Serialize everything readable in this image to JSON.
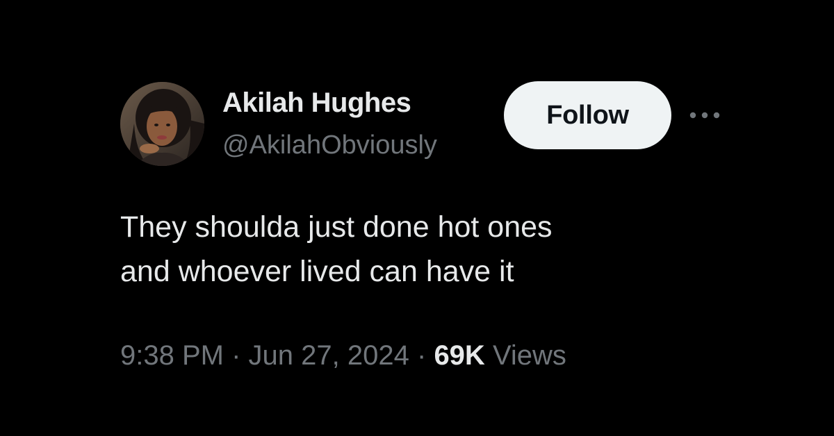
{
  "author": {
    "display_name": "Akilah Hughes",
    "handle": "@AkilahObviously",
    "avatar_alt": "profile photo"
  },
  "follow_button": {
    "label": "Follow"
  },
  "more_button": {
    "icon": "more-horizontal-icon"
  },
  "tweet": {
    "text_lines": [
      "They shoulda just done hot ones",
      "and whoever lived can have it"
    ]
  },
  "meta": {
    "time": "9:38 PM",
    "separator": "·",
    "date": "Jun 27, 2024",
    "views_count": "69K",
    "views_label": "Views"
  },
  "colors": {
    "background": "#000000",
    "primary_text": "#e7e9ea",
    "secondary_text": "#71767b",
    "follow_bg": "#eff3f4"
  }
}
